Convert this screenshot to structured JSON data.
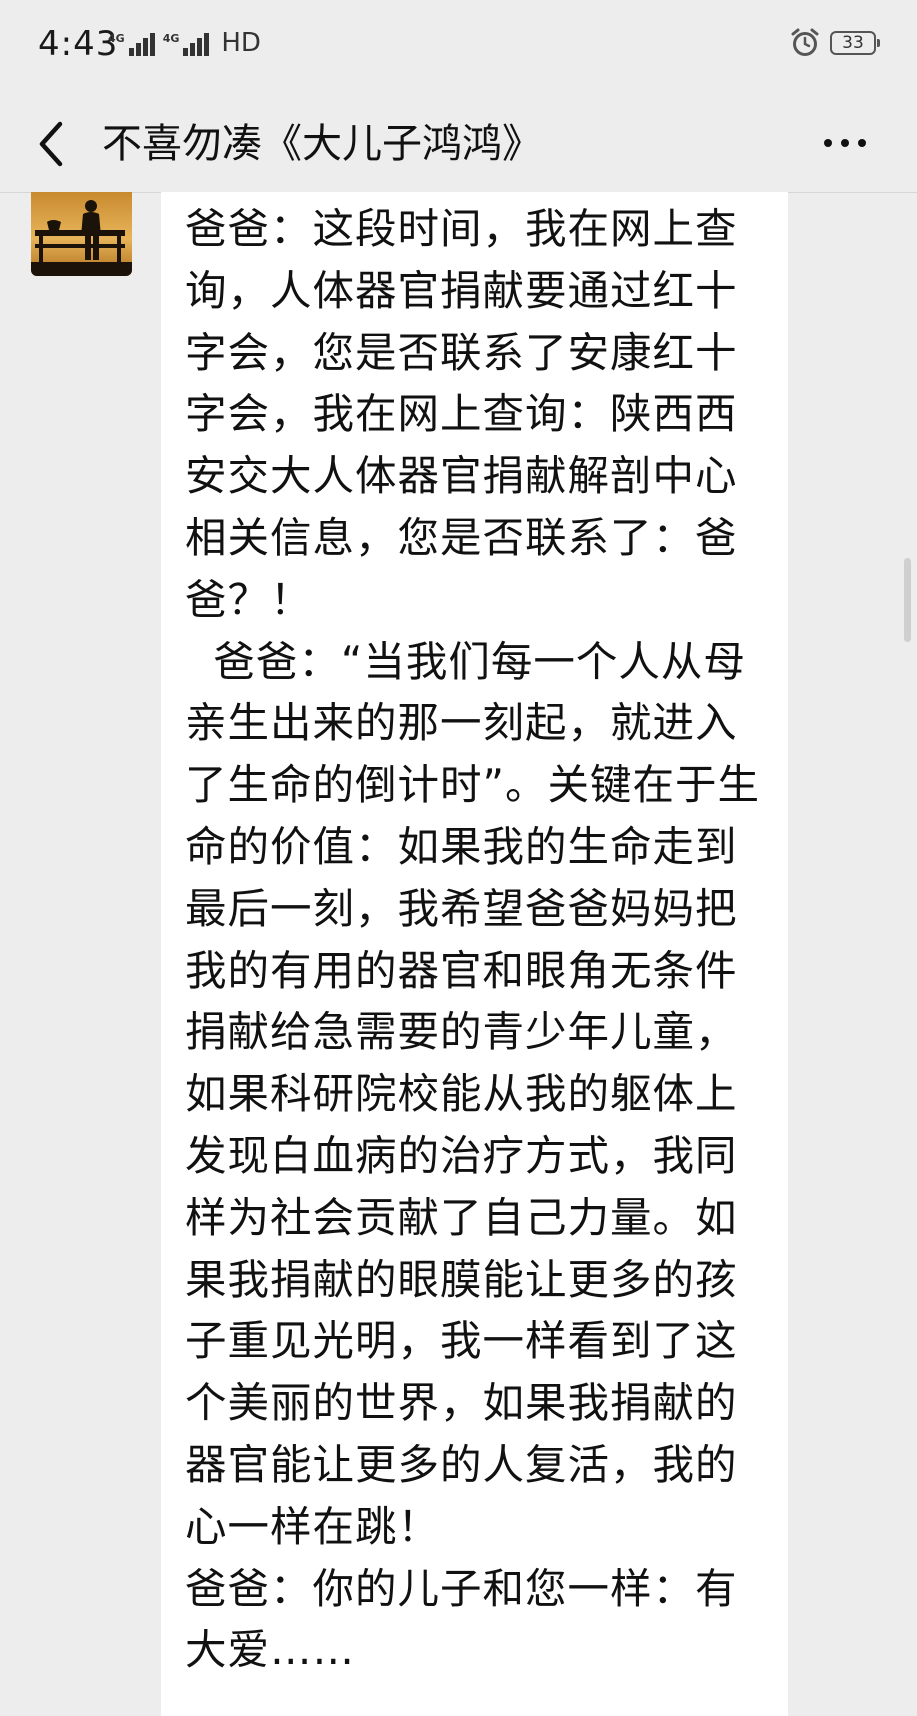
{
  "status_bar": {
    "time": "4:43",
    "network_1": "4G",
    "network_2": "4G",
    "hd_label": "HD",
    "battery_level": "33",
    "alarm": "alarm-clock-icon"
  },
  "header": {
    "back": "back-chevron-icon",
    "title": "不喜勿凑《大儿子鸿鸿》",
    "more": "more-dots-icon"
  },
  "message": {
    "text": "爸爸：这段时间，我在网上查询，人体器官捐献要通过红十字会，您是否联系了安康红十字会，我在网上查询：陕西西安交大人体器官捐献解剖中心相关信息，您是否联系了：爸爸？！\n  爸爸：“当我们每一个人从母亲生出来的那一刻起，就进入了生命的倒计时”。关键在于生命的价值：如果我的生命走到最后一刻，我希望爸爸妈妈把我的有用的器官和眼角无条件捐献给急需要的青少年儿童，如果科研院校能从我的躯体上发现白血病的治疗方式，我同样为社会贡献了自己力量。如果我捐献的眼膜能让更多的孩子重见光明，我一样看到了这个美丽的世界，如果我捐献的器官能让更多的人复活，我的心一样在跳！\n爸爸：你的儿子和您一样：有大爱……"
  }
}
